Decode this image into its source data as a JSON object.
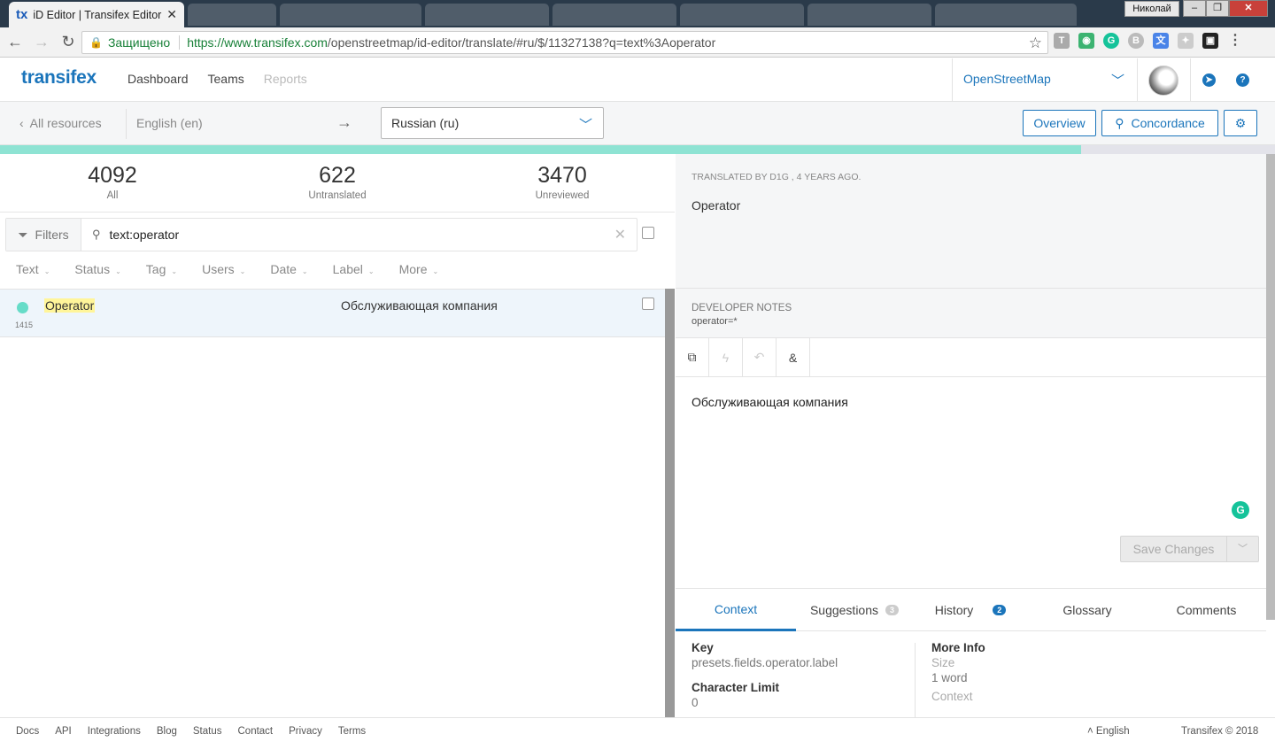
{
  "browser": {
    "tab_title": "iD Editor | Transifex Editor",
    "tab_favicon": "tx",
    "window_user": "Николай",
    "security_label": "Защищено",
    "url_host": "https://www.transifex.com",
    "url_path": "/openstreetmap/id-editor/translate/#ru/$/11327138?q=text%3Aoperator"
  },
  "header": {
    "logo": "transifex",
    "nav": [
      "Dashboard",
      "Teams",
      "Reports"
    ],
    "project": "OpenStreetMap"
  },
  "toolbar": {
    "all_resources": "All resources",
    "source_language": "English (en)",
    "arrow": "→",
    "target_language": "Russian (ru)",
    "overview": "Overview",
    "concordance": "Concordance"
  },
  "progress": {
    "translated_fraction": 0.848
  },
  "stats": [
    {
      "count": "4092",
      "label": "All"
    },
    {
      "count": "622",
      "label": "Untranslated"
    },
    {
      "count": "3470",
      "label": "Unreviewed"
    }
  ],
  "filters": {
    "button": "Filters",
    "query": "text:operator",
    "columns": [
      "Text",
      "Status",
      "Tag",
      "Users",
      "Date",
      "Label",
      "More"
    ]
  },
  "strings": [
    {
      "source": "Operator",
      "id": "1415",
      "translation": "Обслуживающая компания"
    }
  ],
  "detail": {
    "translated_by": "TRANSLATED BY D1G , 4 YEARS AGO.",
    "current_translation": "Operator",
    "dev_notes_title": "DEVELOPER NOTES",
    "dev_notes_value": "operator=*",
    "editor_text": "Обслуживающая компания",
    "save_label": "Save Changes"
  },
  "tabs": [
    {
      "label": "Context",
      "badge": ""
    },
    {
      "label": "Suggestions",
      "badge": "3"
    },
    {
      "label": "History",
      "badge": "2"
    },
    {
      "label": "Glossary",
      "badge": ""
    },
    {
      "label": "Comments",
      "badge": ""
    }
  ],
  "context": {
    "key_label": "Key",
    "key_value": "presets.fields.operator.label",
    "limit_label": "Character Limit",
    "limit_value": "0",
    "more_info_label": "More Info",
    "size_label": "Size",
    "size_value": "1 word",
    "context_label": "Context"
  },
  "footer": {
    "links": [
      "Docs",
      "API",
      "Integrations",
      "Blog",
      "Status",
      "Contact",
      "Privacy",
      "Terms"
    ],
    "language": "English",
    "copyright": "Transifex © 2018"
  },
  "colors": {
    "brand": "#1b75bb",
    "progress": "#8ee3d3",
    "status_dot": "#66dcc8",
    "highlight": "#fff59a"
  }
}
